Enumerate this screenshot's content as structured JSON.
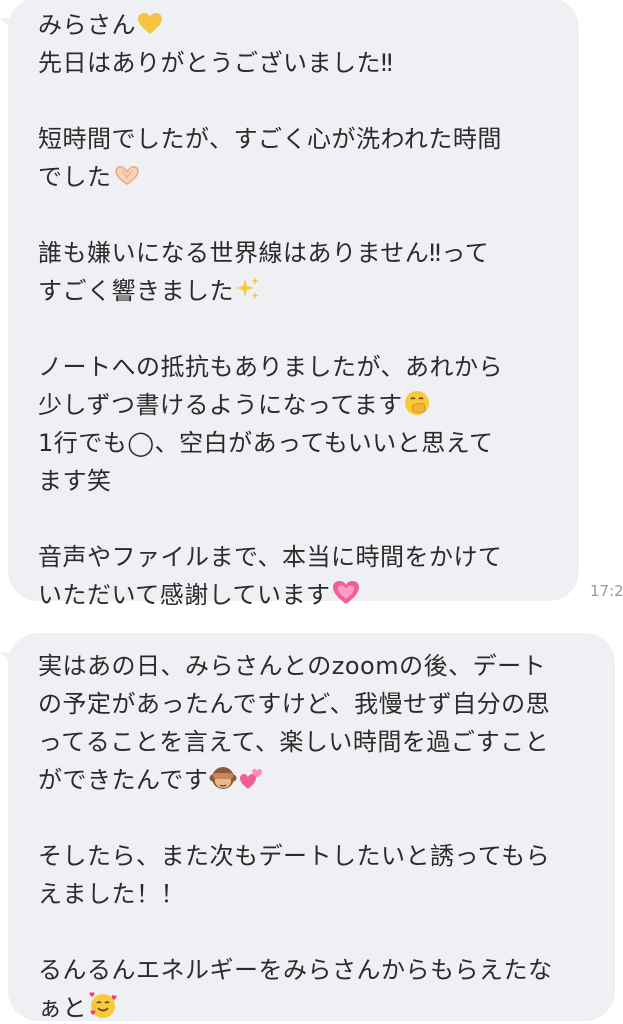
{
  "messages": [
    {
      "timestamp": "17:2",
      "lines": [
        {
          "text": "みらさん",
          "emoji": "yellow-heart"
        },
        {
          "text": "先日はありがとうございました‼︎"
        },
        {
          "text": ""
        },
        {
          "text": "短時間でしたが、すごく心が洗われた時間"
        },
        {
          "text": "でした",
          "emoji": "heart-hands"
        },
        {
          "text": ""
        },
        {
          "text": "誰も嫌いになる世界線はありません‼︎って"
        },
        {
          "text": "すごく響きました",
          "emoji": "sparkles"
        },
        {
          "text": ""
        },
        {
          "text": "ノートへの抵抗もありましたが、あれから"
        },
        {
          "text": "少しずつ書けるようになってます",
          "emoji": "hand-over-mouth"
        },
        {
          "text": "1行でも◯、空白があってもいいと思えて"
        },
        {
          "text": "ます笑"
        },
        {
          "text": ""
        },
        {
          "text": "音声やファイルまで、本当に時間をかけて"
        },
        {
          "text": "いただいて感謝しています",
          "emoji": "growing-heart"
        }
      ]
    },
    {
      "lines": [
        {
          "text": "実はあの日、みらさんとのzoomの後、デート"
        },
        {
          "text": "の予定があったんですけど、我慢せず自分の思"
        },
        {
          "text": "ってることを言えて、楽しい時間を過ごすこと"
        },
        {
          "text": "ができたんです",
          "emoji": "see-no-evil-monkey,two-hearts"
        },
        {
          "text": ""
        },
        {
          "text": "そしたら、また次もデートしたいと誘ってもら"
        },
        {
          "text": "えました！！"
        },
        {
          "text": ""
        },
        {
          "text": "るんるんエネルギーをみらさんからもらえたな"
        },
        {
          "text": "ぁと",
          "emoji": "smiling-face-with-hearts"
        }
      ]
    }
  ],
  "colors": {
    "bubble": "#eff0f3",
    "text": "#2b2b2b",
    "timestamp": "#9a9a9a"
  }
}
